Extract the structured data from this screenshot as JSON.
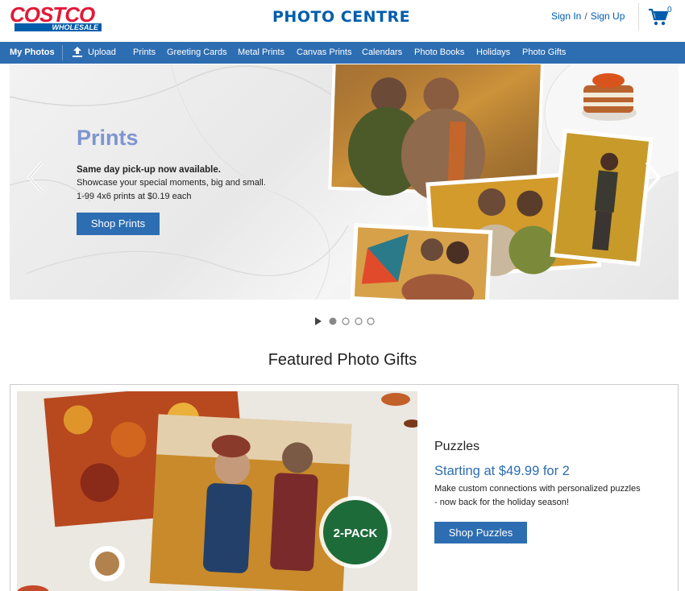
{
  "header": {
    "logo_top": "COSTCO",
    "logo_bottom": "WHOLESALE",
    "site_title": "PHOTO CENTRE",
    "sign_in": "Sign In",
    "separator": "/",
    "sign_up": "Sign Up",
    "cart_count": "0",
    "brand_blue": "#005dab",
    "brand_red": "#e31837"
  },
  "nav": {
    "items": [
      "My Photos",
      "Upload",
      "Prints",
      "Greeting Cards",
      "Metal Prints",
      "Canvas Prints",
      "Calendars",
      "Photo Books",
      "Holidays",
      "Photo Gifts"
    ],
    "background": "#2d6db2"
  },
  "hero": {
    "title": "Prints",
    "subtitle": "Same day pick-up now available.",
    "line1": "Showcase your special moments, big and small.",
    "line2": "1-99 4x6 prints at $0.19 each",
    "button": "Shop Prints",
    "prev_icon": "chevron-left-icon",
    "next_icon": "chevron-right-icon"
  },
  "carousel": {
    "play_icon": "play-icon",
    "slide_count": 4,
    "active_slide": 1
  },
  "featured": {
    "title": "Featured Photo Gifts",
    "card": {
      "name": "Puzzles",
      "price": "Starting at $49.99 for 2",
      "desc1": "Make custom connections with personalized puzzles",
      "desc2": "- now back for the holiday season!",
      "button": "Shop Puzzles",
      "badge": "2-PACK"
    }
  }
}
